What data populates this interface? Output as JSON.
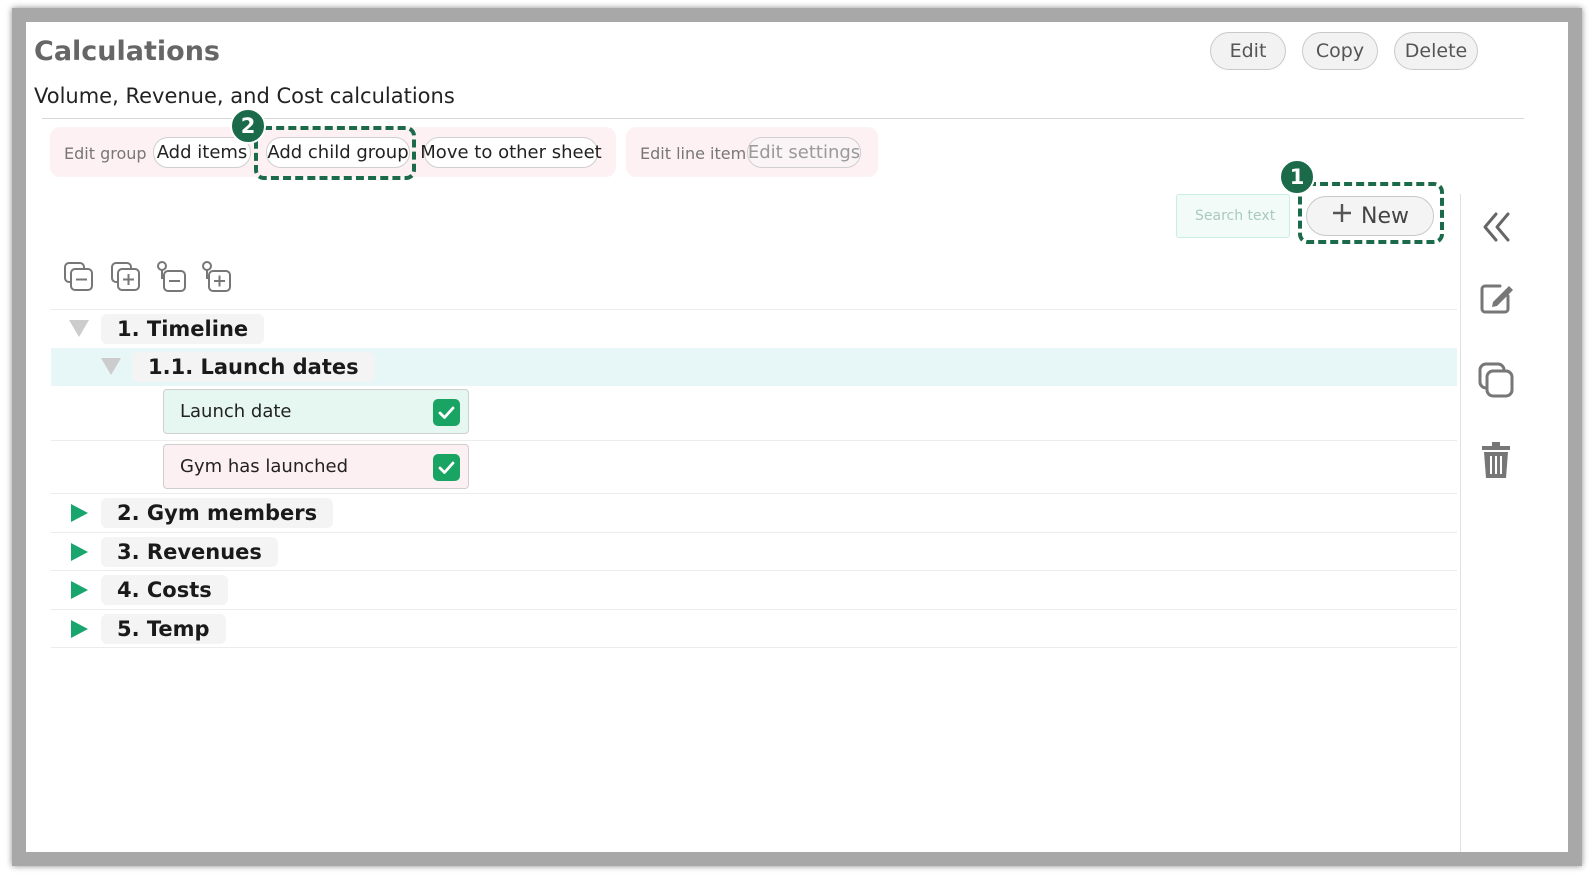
{
  "header": {
    "title": "Calculations",
    "subtitle": "Volume, Revenue, and Cost calculations",
    "actions": {
      "edit": "Edit",
      "copy": "Copy",
      "delete": "Delete"
    }
  },
  "toolbar": {
    "group_section_label": "Edit group",
    "add_items": "Add items",
    "add_child_group": "Add child group",
    "move_to_other_sheet": "Move to other sheet",
    "line_item_section_label": "Edit line item",
    "edit_settings": "Edit settings"
  },
  "markers": {
    "new": "1",
    "add_child_group": "2"
  },
  "search": {
    "placeholder": "Search text"
  },
  "new_button": {
    "label": "New",
    "icon": "plus-icon"
  },
  "tree_tools": [
    "collapse-all-icon",
    "expand-all-icon",
    "collapse-children-icon",
    "expand-children-icon"
  ],
  "tree": {
    "groups": [
      {
        "label": "1. Timeline",
        "expanded": true
      },
      {
        "label": "1.1. Launch dates",
        "expanded": true,
        "selected": true
      },
      {
        "label": "2. Gym members",
        "expanded": false
      },
      {
        "label": "3. Revenues",
        "expanded": false
      },
      {
        "label": "4. Costs",
        "expanded": false
      },
      {
        "label": "5. Temp",
        "expanded": false
      }
    ],
    "items": [
      {
        "label": "Launch date",
        "checked": true,
        "color": "#e6f7f1"
      },
      {
        "label": "Gym has launched",
        "checked": true,
        "color": "#fdf0f3"
      }
    ]
  },
  "side_icons": [
    "collapse-panel-icon",
    "edit-icon",
    "copy-icon",
    "delete-icon"
  ],
  "colors": {
    "accent": "#1b6b4b",
    "expand_arrow": "#18a56e",
    "check": "#19a463",
    "selected_row": "#e7f6f6"
  }
}
